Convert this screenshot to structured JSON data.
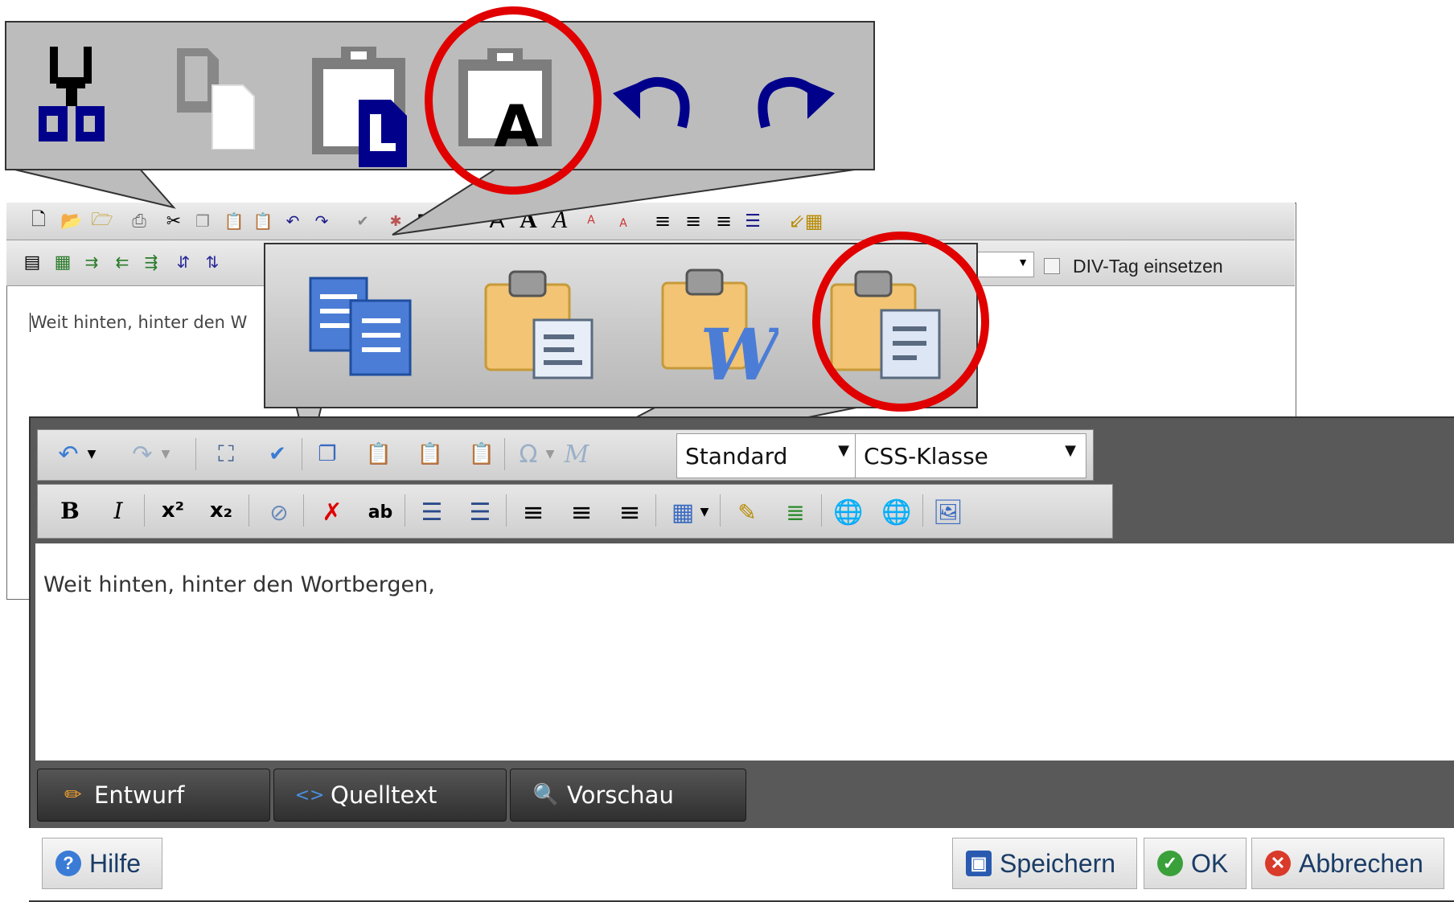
{
  "colors": {
    "highlight_ring": "#e00000",
    "callout_bg": "#bcbcbc",
    "tab_bg": "#3a3a3a",
    "button_text": "#1a3c66",
    "help_icon": "#3a7bd5",
    "ok_icon": "#3aa03a",
    "cancel_icon": "#d93a2a"
  },
  "callout_top": {
    "icons": [
      "cut-icon",
      "copy-icon",
      "paste-icon",
      "paste-text-icon",
      "undo-icon",
      "redo-icon"
    ],
    "highlighted": "paste-text-icon"
  },
  "callout_middle": {
    "icons": [
      "copy-icon",
      "paste-icon",
      "paste-word-icon",
      "paste-text-icon"
    ],
    "highlighted": "paste-text-icon"
  },
  "old_editor": {
    "option_label": "DIV-Tag einsetzen",
    "content": "Weit hinten, hinter den W"
  },
  "new_editor": {
    "format_select": "Standard",
    "css_select": "CSS-Klasse",
    "content": "Weit hinten, hinter den Wortbergen,",
    "tabs": [
      {
        "label": "Entwurf",
        "icon": "pencil-icon"
      },
      {
        "label": "Quelltext",
        "icon": "code-icon"
      },
      {
        "label": "Vorschau",
        "icon": "magnifier-icon"
      }
    ]
  },
  "footer": {
    "help": "Hilfe",
    "save": "Speichern",
    "ok": "OK",
    "cancel": "Abbrechen"
  }
}
